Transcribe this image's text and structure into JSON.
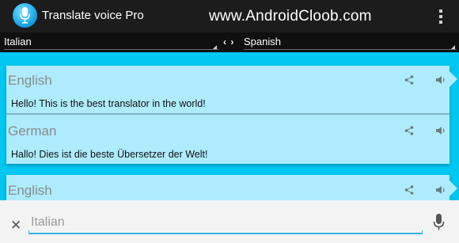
{
  "app": {
    "title": "Translate voice Pro",
    "watermark": "www.AndroidCloob.com",
    "icon": "microphone-app-icon",
    "menu_icon": "overflow-menu-icon"
  },
  "languages": {
    "source": "Italian",
    "target": "Spanish",
    "swap_icon": "swap-icon"
  },
  "cards": [
    {
      "rows": [
        {
          "language": "English",
          "text": "Hello! This is the best translator in the world!"
        },
        {
          "language": "German",
          "text": "Hallo! Dies ist die beste Übersetzer der Welt!"
        }
      ]
    },
    {
      "rows": [
        {
          "language": "English",
          "text": ""
        }
      ]
    }
  ],
  "input": {
    "placeholder": "Italian",
    "value": ""
  },
  "colors": {
    "background": "#00c6f2",
    "card": "#aeecfd",
    "accent": "#33b5e5",
    "actionbar": "#1c1c1c"
  }
}
